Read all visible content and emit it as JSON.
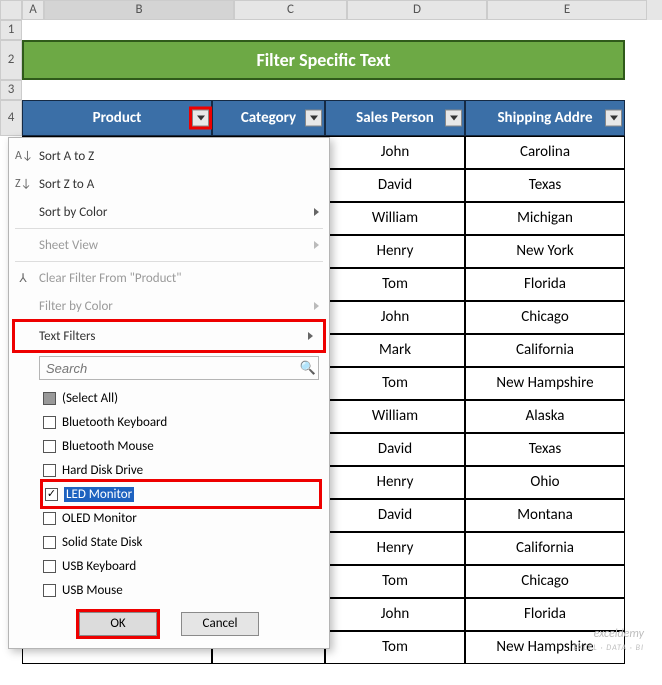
{
  "cols": {
    "A": "A",
    "B": "B",
    "C": "C",
    "D": "D",
    "E": "E"
  },
  "row_numbers": [
    "1",
    "2",
    "3",
    "4"
  ],
  "title": "Filter Specific Text",
  "headers": {
    "product": "Product",
    "category": "Category",
    "sales": "Sales Person",
    "ship": "Shipping Addre"
  },
  "menu": {
    "sort_az": "Sort A to Z",
    "sort_za": "Sort Z to A",
    "sort_color": "Sort by Color",
    "sheet_view": "Sheet View",
    "clear_filter": "Clear Filter From \"Product\"",
    "filter_color": "Filter by Color",
    "text_filters": "Text Filters",
    "search_placeholder": "Search",
    "items": {
      "select_all": "(Select All)",
      "i1": "Bluetooth Keyboard",
      "i2": "Bluetooth Mouse",
      "i3": "Hard Disk Drive",
      "i4": "LED Monitor",
      "i5": "OLED Monitor",
      "i6": "Solid State Disk",
      "i7": "USB Keyboard",
      "i8": "USB Mouse"
    },
    "ok": "OK",
    "cancel": "Cancel"
  },
  "rows": [
    {
      "sales": "John",
      "ship": "Carolina"
    },
    {
      "sales": "David",
      "ship": "Texas"
    },
    {
      "sales": "William",
      "ship": "Michigan"
    },
    {
      "sales": "Henry",
      "ship": "New York"
    },
    {
      "sales": "Tom",
      "ship": "Florida"
    },
    {
      "sales": "John",
      "ship": "Chicago"
    },
    {
      "sales": "Mark",
      "ship": "California"
    },
    {
      "sales": "Tom",
      "ship": "New Hampshire"
    },
    {
      "sales": "William",
      "ship": "Alaska"
    },
    {
      "sales": "David",
      "ship": "Texas"
    },
    {
      "sales": "Henry",
      "ship": "Ohio"
    },
    {
      "sales": "David",
      "ship": "Montana"
    },
    {
      "sales": "Henry",
      "ship": "California"
    },
    {
      "sales": "Tom",
      "ship": "Chicago"
    },
    {
      "sales": "John",
      "ship": "Florida"
    },
    {
      "sales": "Tom",
      "ship": "New Hampshire"
    }
  ],
  "watermark": {
    "l1": "exceldemy",
    "l2": "EXCEL · DATA · BI"
  }
}
